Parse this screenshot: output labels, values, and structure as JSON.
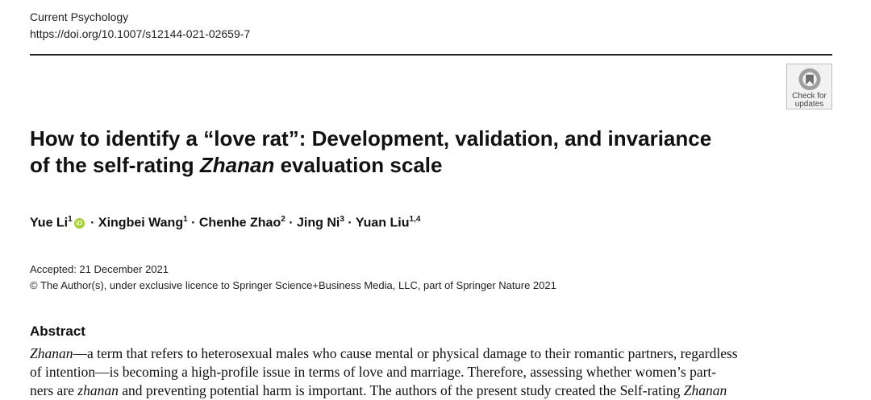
{
  "journal": {
    "name": "Current Psychology",
    "doi": "https://doi.org/10.1007/s12144-021-02659-7"
  },
  "badge": {
    "line1": "Check for",
    "line2": "updates"
  },
  "title": {
    "line1": "How to identify a “love rat”: Development, validation, and invariance",
    "line2_pre": "of the self-rating ",
    "line2_em": "Zhanan",
    "line2_post": " evaluation scale"
  },
  "authors": [
    {
      "name": "Yue Li",
      "sup": "1",
      "orcid": true
    },
    {
      "name": "Xingbei Wang",
      "sup": "1"
    },
    {
      "name": "Chenhe Zhao",
      "sup": "2"
    },
    {
      "name": "Jing Ni",
      "sup": "3"
    },
    {
      "name": "Yuan Liu",
      "sup": "1,4"
    }
  ],
  "dates": {
    "accepted": "Accepted: 21 December 2021",
    "copyright": "© The Author(s), under exclusive licence to Springer Science+Business Media, LLC, part of Springer Nature 2021"
  },
  "abstract": {
    "heading": "Abstract",
    "line1_em": "Zhanan",
    "line1_rest": "—a term that refers to heterosexual males who cause mental or physical damage to their romantic partners, regardless",
    "line2": "of intention—is becoming a high-profile issue in terms of love and marriage. Therefore, assessing whether women’s part-",
    "line3_pre": "ners are ",
    "line3_em1": "zhanan",
    "line3_mid": " and preventing potential harm is important. The authors of the present study created the Self-rating ",
    "line3_em2": "Zhanan"
  }
}
